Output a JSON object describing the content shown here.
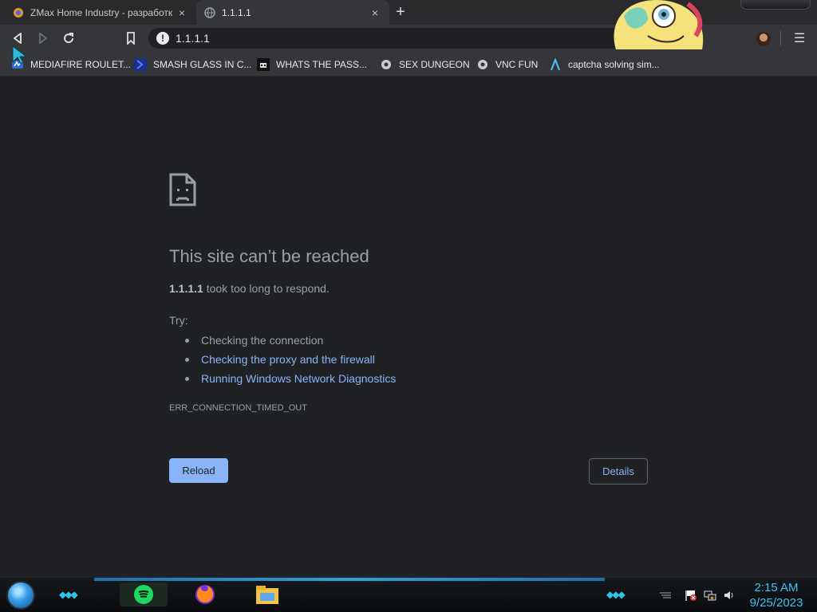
{
  "tabs": [
    {
      "title": "ZMax Home Industry - разработк",
      "close": "×"
    },
    {
      "title": "1.1.1.1",
      "close": "×"
    }
  ],
  "new_tab": "+",
  "address_bar": {
    "url": "1.1.1.1",
    "info_glyph": "!"
  },
  "bookmarks": [
    {
      "label": "MEDIAFIRE ROULET...",
      "icon": "mediafire-icon"
    },
    {
      "label": "SMASH GLASS IN C...",
      "icon": "chevron-bookmark-icon"
    },
    {
      "label": "WHATS THE PASS...",
      "icon": "robot-icon"
    },
    {
      "label": "SEX DUNGEON",
      "icon": "gear-bookmark-icon"
    },
    {
      "label": "VNC FUN",
      "icon": "gear-bookmark-icon"
    },
    {
      "label": "captcha solving sim...",
      "icon": "lambda-icon"
    }
  ],
  "error_page": {
    "heading": "This site can’t be reached",
    "host": "1.1.1.1",
    "desc_rest": " took too long to respond.",
    "try_label": "Try:",
    "suggestions": [
      "Checking the connection",
      "Checking the proxy and the firewall",
      "Running Windows Network Diagnostics"
    ],
    "error_code": "ERR_CONNECTION_TIMED_OUT",
    "reload_label": "Reload",
    "details_label": "Details"
  },
  "taskbar": {
    "time": "2:15 AM",
    "date": "9/25/2023"
  },
  "colors": {
    "link": "#8ab4f8",
    "accent": "#3fc5f0"
  }
}
